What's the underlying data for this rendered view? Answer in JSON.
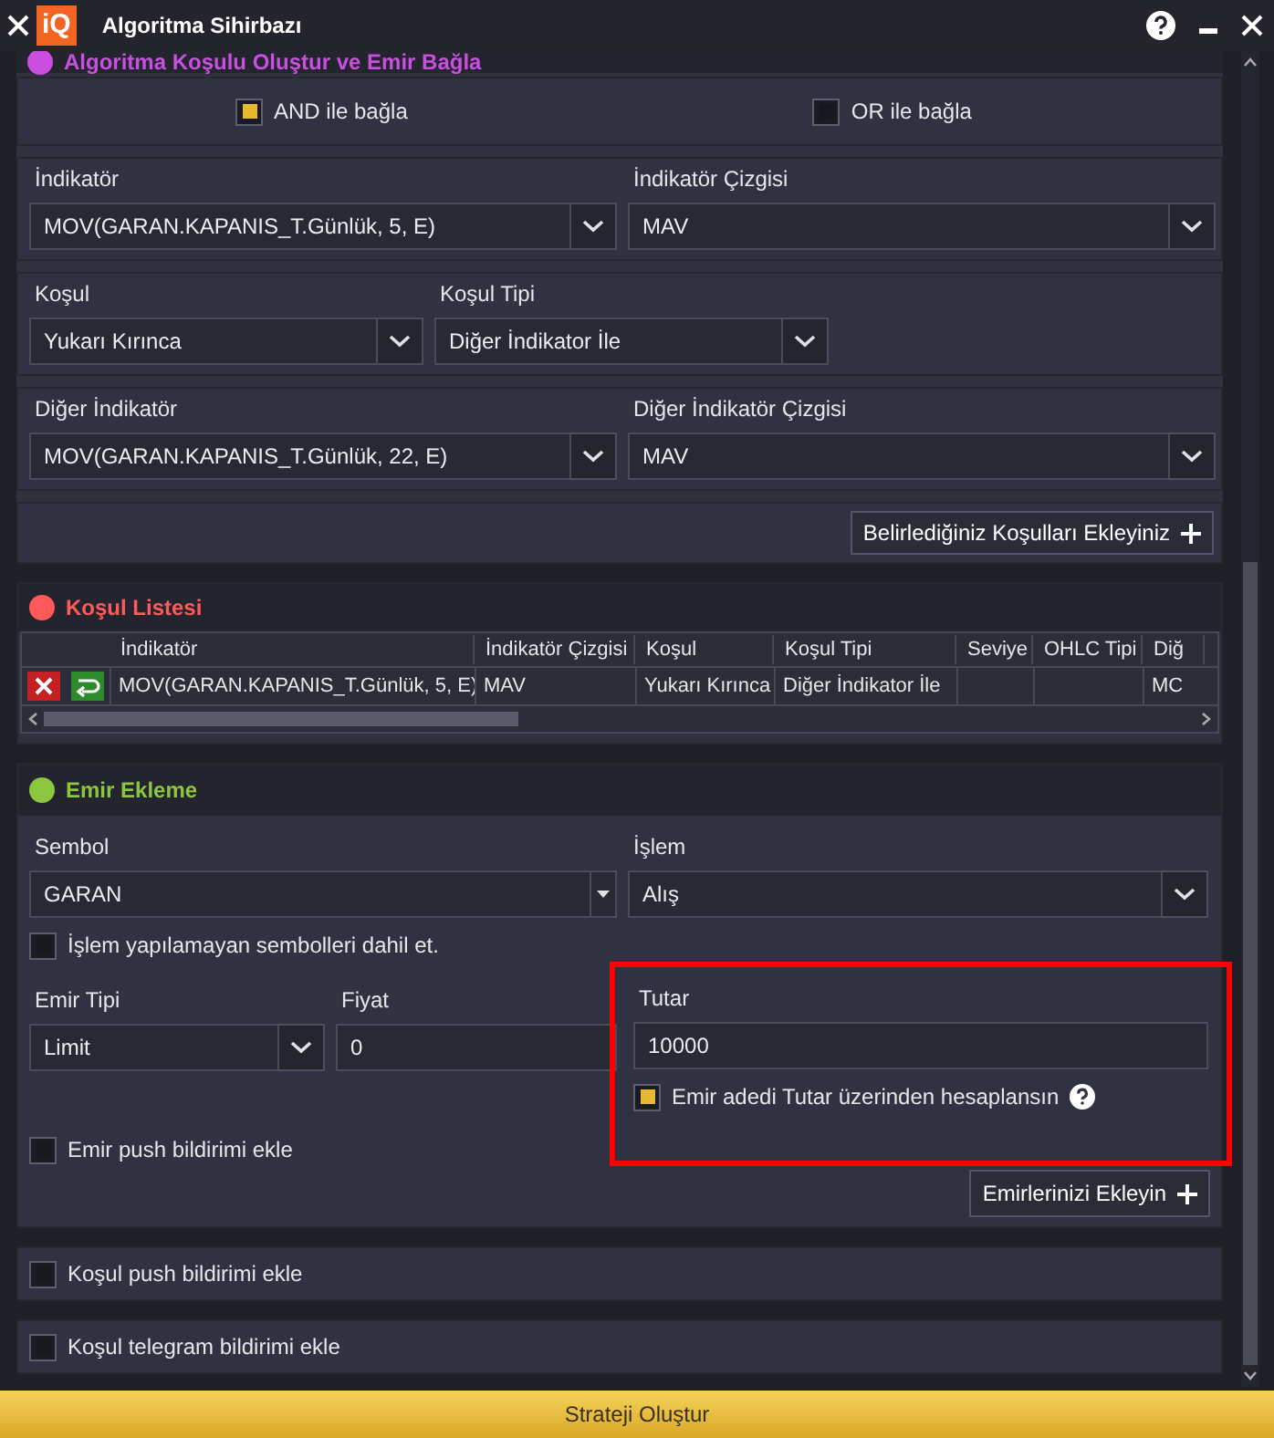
{
  "window": {
    "title": "Algoritma Sihirbazı",
    "logo": "iQ"
  },
  "condition_section": {
    "title": "Algoritma Koşulu Oluştur ve Emir Bağla",
    "color": "#c94fe0",
    "join_options": [
      {
        "label": "AND ile bağla",
        "checked": true
      },
      {
        "label": "OR ile bağla",
        "checked": false
      }
    ],
    "field_rows": [
      {
        "kind": "wide",
        "fields": [
          {
            "label": "İndikatör",
            "value": "MOV(GARAN.KAPANIS_T.Günlük, 5, E)",
            "kind": "select"
          },
          {
            "label": "İndikatör Çizgisi",
            "value": "MAV",
            "kind": "select"
          }
        ]
      },
      {
        "kind": "narrow",
        "fields": [
          {
            "label": "Koşul",
            "value": "Yukarı Kırınca",
            "kind": "select"
          },
          {
            "label": "Koşul Tipi",
            "value": "Diğer İndikator İle",
            "kind": "select"
          }
        ]
      },
      {
        "kind": "wide",
        "fields": [
          {
            "label": "Diğer İndikatör",
            "value": "MOV(GARAN.KAPANIS_T.Günlük, 22, E)",
            "kind": "select"
          },
          {
            "label": "Diğer İndikatör Çizgisi",
            "value": "MAV",
            "kind": "select"
          }
        ]
      }
    ],
    "add_button": "Belirlediğiniz Koşulları Ekleyiniz"
  },
  "condition_list": {
    "title": "Koşul Listesi",
    "color": "#ff5a5a",
    "columns": [
      "İndikatör",
      "İndikatör Çizgisi",
      "Koşul",
      "Koşul Tipi",
      "Seviye",
      "OHLC Tipi",
      "Diğ"
    ],
    "rows": [
      {
        "cells": [
          "MOV(GARAN.KAPANIS_T.Günlük, 5, E)",
          "MAV",
          "Yukarı Kırınca",
          "Diğer İndikator İle",
          "",
          "",
          "MC"
        ]
      }
    ]
  },
  "order_section": {
    "title": "Emir Ekleme",
    "color": "#8cc63f",
    "symbol": {
      "label": "Sembol",
      "value": "GARAN",
      "kind": "combo"
    },
    "action": {
      "label": "İşlem",
      "value": "Alış",
      "kind": "select"
    },
    "include_untradable": {
      "label": "İşlem yapılamayan sembolleri dahil et.",
      "checked": false
    },
    "order_type": {
      "label": "Emir Tipi",
      "value": "Limit",
      "kind": "select"
    },
    "price": {
      "label": "Fiyat",
      "value": "0",
      "kind": "text"
    },
    "amount": {
      "label": "Tutar",
      "value": "10000",
      "kind": "text",
      "highlighted": true
    },
    "amount_based": {
      "label": "Emir adedi Tutar üzerinden hesaplansın",
      "checked": true
    },
    "push": {
      "label": "Emir push bildirimi ekle",
      "checked": false
    },
    "add_button": "Emirlerinizi Ekleyin"
  },
  "notifications": [
    {
      "label": "Koşul push bildirimi ekle",
      "checked": false
    },
    {
      "label": "Koşul telegram bildirimi ekle",
      "checked": false
    }
  ],
  "submit_button": "Strateji Oluştur"
}
